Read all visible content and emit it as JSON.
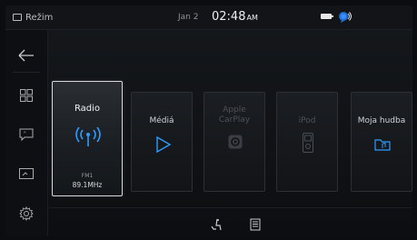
{
  "status": {
    "mode_label": "Režim",
    "date": "Jan 2",
    "time": "02:48",
    "ampm": "AM"
  },
  "sources": [
    {
      "label": "Radio",
      "sub1": "FM1",
      "sub2": "89.1MHz",
      "active": true
    },
    {
      "label": "Médiá",
      "active": false
    },
    {
      "label_line1": "Apple",
      "label_line2": "CarPlay",
      "disabled": true
    },
    {
      "label": "iPod",
      "disabled": true
    },
    {
      "label": "Moja hudba",
      "active": false
    }
  ],
  "colors": {
    "accent": "#1e90ff",
    "active_border": "#d6d8db",
    "disabled_text": "#4e5257"
  },
  "icons": {
    "sidebar": [
      "back-arrow-icon",
      "apps-grid-icon",
      "message-icon",
      "screen-icon",
      "settings-gear-icon"
    ],
    "bottom": [
      "seat-icon",
      "manual-icon"
    ]
  }
}
